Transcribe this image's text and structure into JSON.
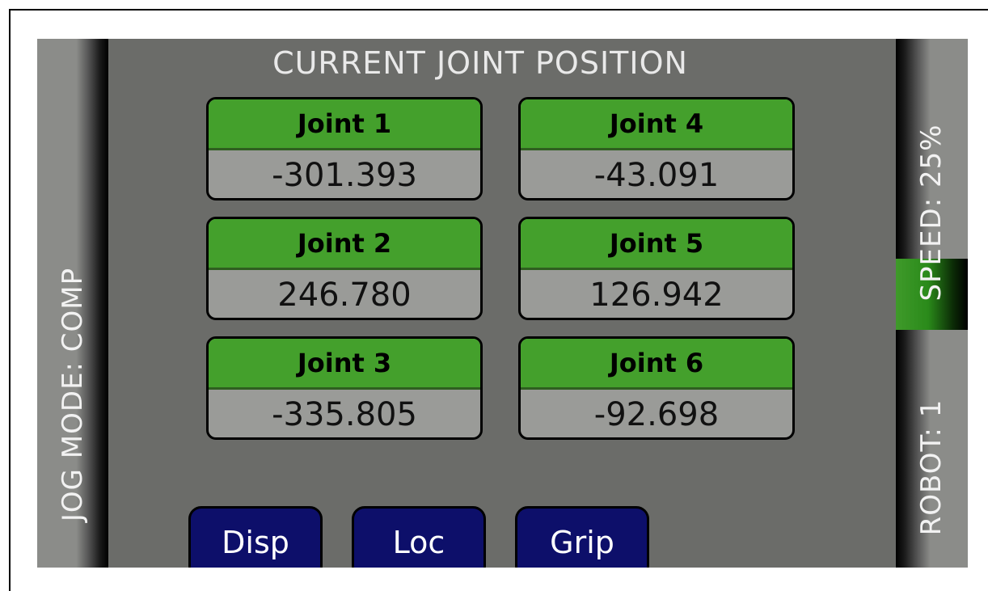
{
  "screen": {
    "title": "CURRENT JOINT POSITION",
    "jog_mode": "JOG MODE: COMP",
    "speed": "SPEED: 25%",
    "robot": "ROBOT: 1"
  },
  "joints": [
    {
      "label": "Joint 1",
      "value": "-301.393"
    },
    {
      "label": "Joint 2",
      "value": "246.780"
    },
    {
      "label": "Joint 3",
      "value": "-335.805"
    },
    {
      "label": "Joint 4",
      "value": "-43.091"
    },
    {
      "label": "Joint 5",
      "value": "126.942"
    },
    {
      "label": "Joint 6",
      "value": "-92.698"
    }
  ],
  "buttons": {
    "disp": "Disp",
    "loc": "Loc",
    "grip": "Grip"
  },
  "colors": {
    "background": "#6b6c69",
    "header_green": "#44a02c",
    "value_gray": "#9a9b98",
    "button_navy": "#0d0f6a"
  }
}
